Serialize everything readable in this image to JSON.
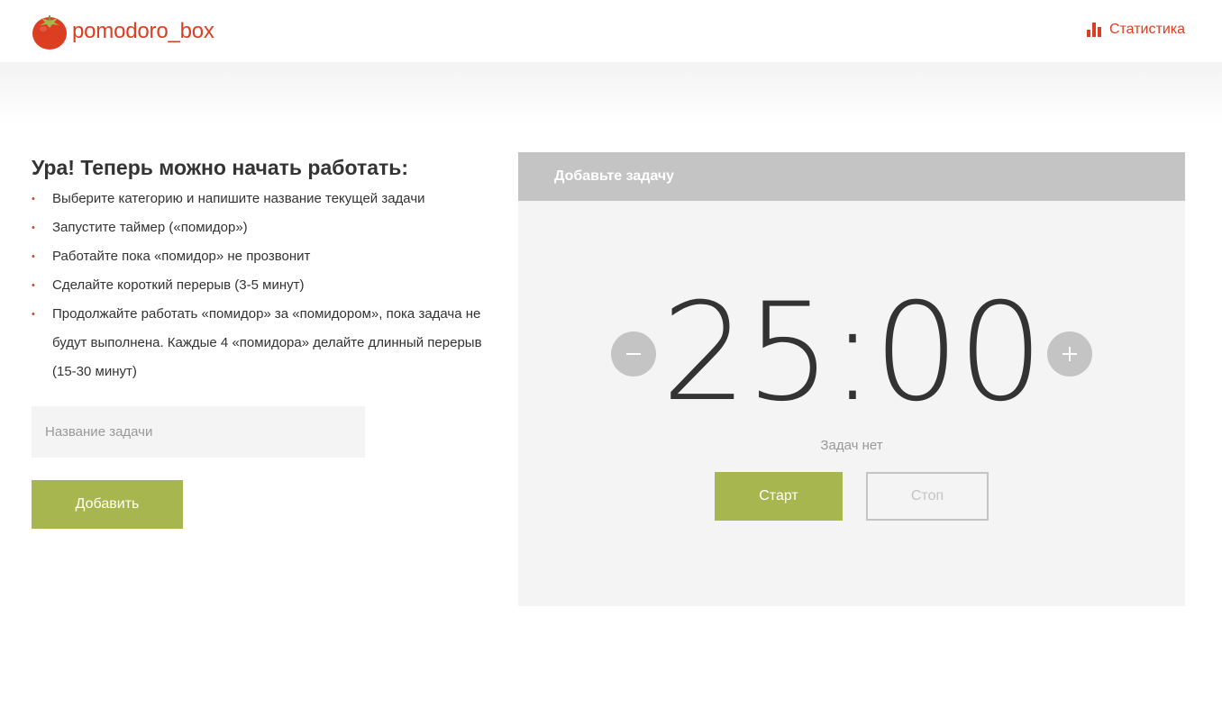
{
  "app": {
    "logo_text": "pomodoro_box",
    "logo_icon": "tomato-icon",
    "accent_color": "#DC3E22"
  },
  "header": {
    "stats_label": "Статистика",
    "stats_icon": "bar-chart-icon"
  },
  "intro": {
    "title": "Ура! Теперь можно начать работать:",
    "steps": [
      "Выберите категорию и напишите название текущей задачи",
      "Запустите таймер («помидор»)",
      "Работайте пока «помидор» не прозвонит",
      "Сделайте короткий перерыв (3-5 минут)",
      "Продолжайте работать «помидор» за «помидором», пока задача не будут выполнена. Каждые 4 «помидора» делайте длинный перерыв (15-30 минут)"
    ]
  },
  "task_form": {
    "input_value": "",
    "input_placeholder": "Название задачи",
    "add_label": "Добавить",
    "button_color": "#A8B64F"
  },
  "timer": {
    "header_text": "Добавьте задачу",
    "time": "25:00",
    "status_text": "Задач нет",
    "start_label": "Старт",
    "stop_label": "Стоп",
    "decrease_icon": "minus-icon",
    "increase_icon": "plus-icon"
  }
}
